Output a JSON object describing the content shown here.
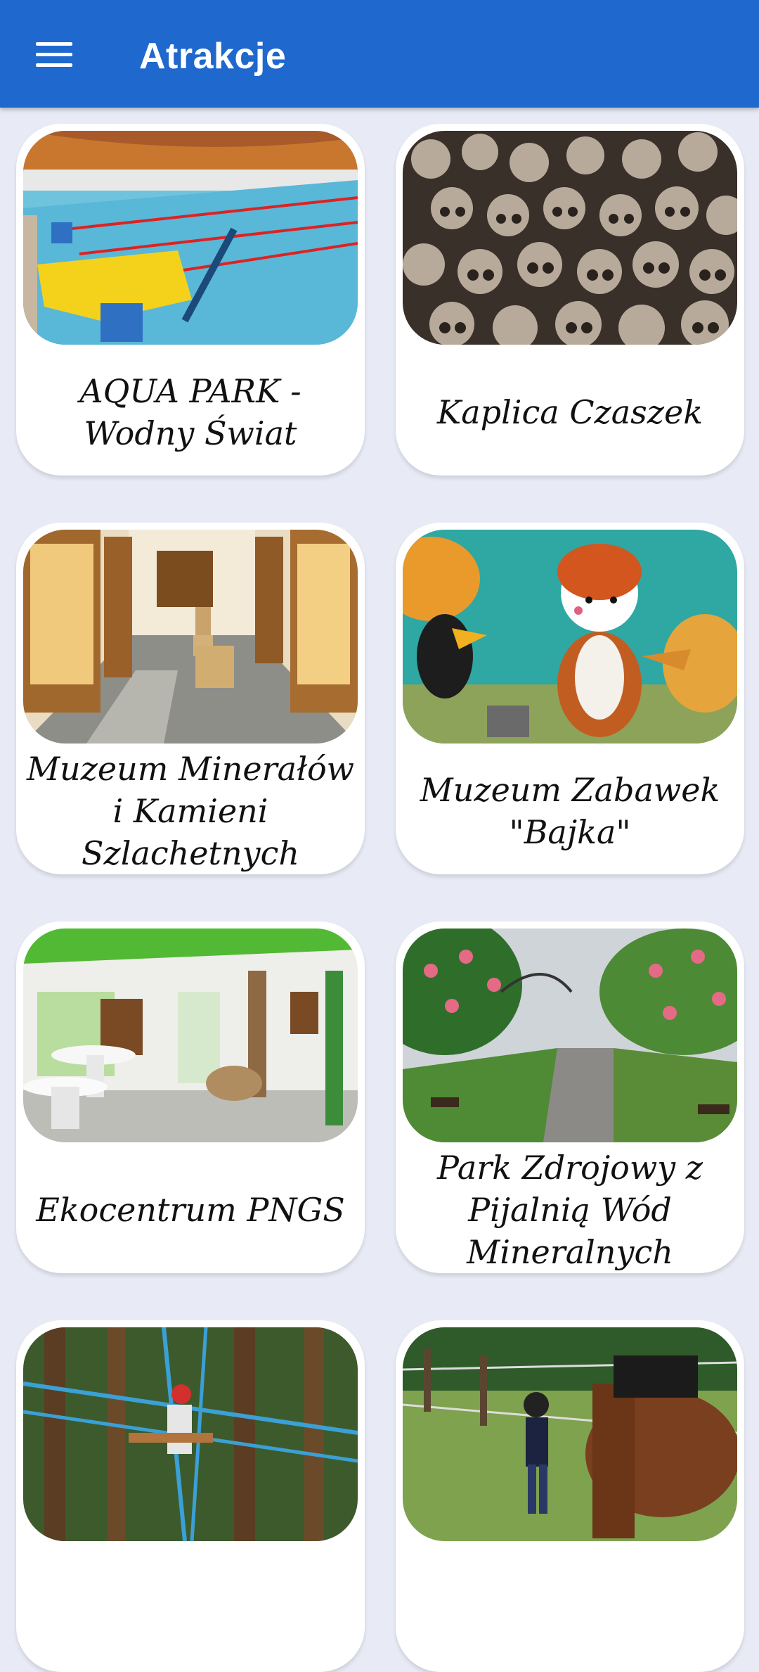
{
  "appbar": {
    "title": "Atrakcje",
    "menu_icon": "hamburger-menu-icon",
    "color": "#1f68cd"
  },
  "attractions": [
    {
      "name": "AQUA PARK - Wodny Świat"
    },
    {
      "name": "Kaplica Czaszek"
    },
    {
      "name": "Muzeum Minerałów i Kamieni Szlachetnych"
    },
    {
      "name": "Muzeum Zabawek \"Bajka\""
    },
    {
      "name": "Ekocentrum PNGS"
    },
    {
      "name": "Park Zdrojowy z Pijalnią Wód Mineralnych"
    },
    {
      "name": ""
    },
    {
      "name": ""
    }
  ]
}
